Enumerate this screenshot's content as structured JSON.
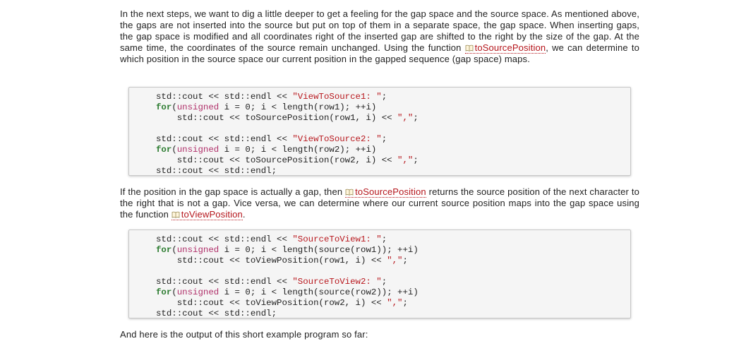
{
  "para1": {
    "text_before": "In the next steps, we want to dig a little deeper to get a feeling for the gap space and the source space. As mentioned above, the gaps are not inserted into the source but put on top of them in a separate space, the gap space. When inserting gaps, the gap space is modified and all coordinates right of the inserted gap are shifted to the right by the size of the gap. At the same time, the coordinates of the source remain unchanged. Using the function ",
    "link": "toSourcePosition",
    "text_after": ", we can determine to which position in the source space our current position in the gapped sequence (gap space) maps."
  },
  "code1": {
    "b1l1_a": "std::cout << std::endl << ",
    "b1l1_s": "\"ViewToSource1: \"",
    "b1l1_c": ";",
    "b1l2_kw": "for",
    "b1l2_p": "(",
    "b1l2_ty": "unsigned",
    "b1l2_rest": " i = 0; i < length(row1); ++i)",
    "b1l3_a": "    std::cout << toSourcePosition(row1, i) << ",
    "b1l3_s": "\",\"",
    "b1l3_c": ";",
    "b2l1_a": "std::cout << std::endl << ",
    "b2l1_s": "\"ViewToSource2: \"",
    "b2l1_c": ";",
    "b2l2_kw": "for",
    "b2l2_p": "(",
    "b2l2_ty": "unsigned",
    "b2l2_rest": " i = 0; i < length(row2); ++i)",
    "b2l3_a": "    std::cout << toSourcePosition(row2, i) << ",
    "b2l3_s": "\",\"",
    "b2l3_c": ";",
    "b2l4": "std::cout << std::endl;"
  },
  "para2": {
    "text_before": "If the position in the gap space is actually a gap, then ",
    "link1": "toSourcePosition",
    "text_middle": " returns the source position of the next character to the right that is not a gap. Vice versa, we can determine where our current source position maps into the gap space using the function ",
    "link2": "toViewPosition",
    "text_after": "."
  },
  "code2": {
    "b1l1_a": "std::cout << std::endl << ",
    "b1l1_s": "\"SourceToView1: \"",
    "b1l1_c": ";",
    "b1l2_kw": "for",
    "b1l2_p": "(",
    "b1l2_ty": "unsigned",
    "b1l2_rest": " i = 0; i < length(source(row1)); ++i)",
    "b1l3_a": "    std::cout << toViewPosition(row1, i) << ",
    "b1l3_s": "\",\"",
    "b1l3_c": ";",
    "b2l1_a": "std::cout << std::endl << ",
    "b2l1_s": "\"SourceToView2: \"",
    "b2l1_c": ";",
    "b2l2_kw": "for",
    "b2l2_p": "(",
    "b2l2_ty": "unsigned",
    "b2l2_rest": " i = 0; i < length(source(row2)); ++i)",
    "b2l3_a": "    std::cout << toViewPosition(row2, i) << ",
    "b2l3_s": "\",\"",
    "b2l3_c": ";",
    "b2l4": "std::cout << std::endl;"
  },
  "para3": {
    "text": "And here is the output of this short example program so far:"
  },
  "colors": {
    "link": "#b5151b",
    "keyword": "#2e7d32",
    "type": "#b0306a",
    "string": "#b8181e"
  },
  "icons": {
    "link_icon": "open-book-icon"
  }
}
